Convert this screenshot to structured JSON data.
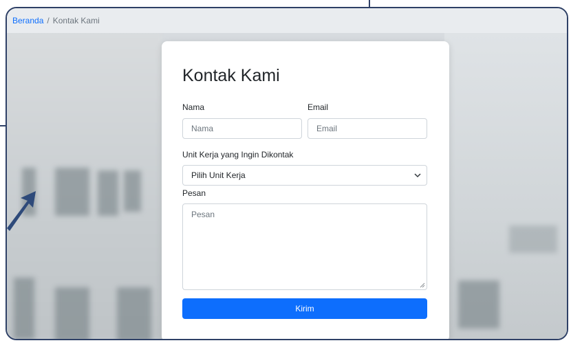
{
  "breadcrumb": {
    "home": "Beranda",
    "separator": "/",
    "current": "Kontak Kami"
  },
  "form": {
    "title": "Kontak Kami",
    "name_label": "Nama",
    "name_placeholder": "Nama",
    "email_label": "Email",
    "email_placeholder": "Email",
    "unit_label": "Unit Kerja yang Ingin Dikontak",
    "unit_selected": "Pilih Unit Kerja",
    "message_label": "Pesan",
    "message_placeholder": "Pesan",
    "submit_label": "Kirim"
  },
  "colors": {
    "primary": "#0d6efd",
    "frame_border": "#2e4066",
    "breadcrumb_bg": "#e9ecef"
  },
  "icons": {
    "select_caret": "chevron-down-icon",
    "textarea_resize": "resize-handle-icon",
    "pointer": "arrow-icon"
  }
}
